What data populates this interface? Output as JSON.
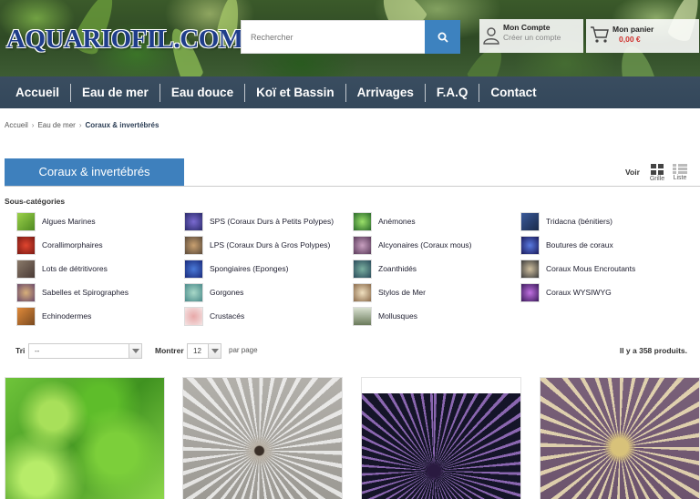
{
  "header": {
    "logo": "AQUARIOFIL.COM",
    "search_placeholder": "Rechercher",
    "account_title": "Mon Compte",
    "account_sub": "Créer un compte",
    "cart_title": "Mon panier",
    "cart_price": "0,00 €"
  },
  "nav": [
    "Accueil",
    "Eau de mer",
    "Eau douce",
    "Koï et Bassin",
    "Arrivages",
    "F.A.Q",
    "Contact"
  ],
  "breadcrumb": [
    "Accueil",
    "Eau de mer",
    "Coraux & invertébrés"
  ],
  "category_title": "Coraux & invertébrés",
  "view": {
    "label": "Voir",
    "grid": "Grille",
    "list": "Liste"
  },
  "subcategories_heading": "Sous-catégories",
  "subcategories": [
    [
      "Algues Marines",
      "Corallimorphaires",
      "Lots de détritivores",
      "Sabelles et Spirographes",
      "Echinodermes"
    ],
    [
      "SPS (Coraux Durs à Petits Polypes)",
      "LPS (Coraux Durs à Gros Polypes)",
      "Spongiaires (Eponges)",
      "Gorgones",
      "Crustacés"
    ],
    [
      "Anémones",
      "Alcyonaires (Coraux mous)",
      "Zoanthidés",
      "Stylos de Mer",
      "Mollusques"
    ],
    [
      "Tridacna (bénitiers)",
      "Boutures de coraux",
      "Coraux Mous Encroutants",
      "Coraux WYSIWYG"
    ]
  ],
  "sort": {
    "label": "Tri",
    "value": "--",
    "show_label": "Montrer",
    "show_value": "12",
    "per_page": "par page",
    "count": "Il y a 358 produits."
  },
  "colors": {
    "accent": "#3e80bd",
    "nav": "#33475a"
  }
}
